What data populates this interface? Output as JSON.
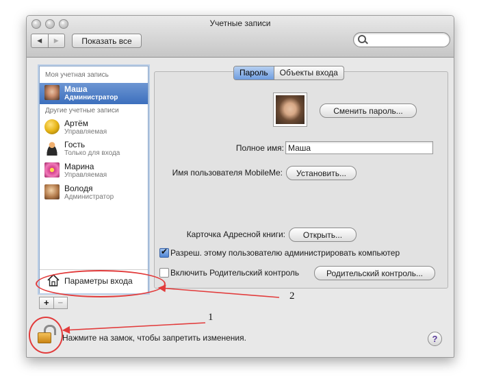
{
  "window": {
    "title": "Учетные записи"
  },
  "toolbar": {
    "back_label": "◀",
    "forward_label": "▶",
    "show_all_label": "Показать все",
    "search_placeholder": ""
  },
  "sidebar": {
    "my_account_header": "Моя учетная запись",
    "my_account": {
      "name": "Маша",
      "role": "Администратор",
      "avatar_color": "#c98b6a"
    },
    "other_accounts_header": "Другие учетные записи",
    "others": [
      {
        "name": "Артём",
        "role": "Управляемая",
        "avatar_color": "#e6b417"
      },
      {
        "name": "Гость",
        "role": "Только для входа",
        "avatar_color": "#b26a2c"
      },
      {
        "name": "Марина",
        "role": "Управляемая",
        "avatar_color": "#d43c8c"
      },
      {
        "name": "Володя",
        "role": "Администратор",
        "avatar_color": "#b27a4a"
      }
    ],
    "login_options_label": "Параметры входа",
    "add_label": "+",
    "remove_label": "−"
  },
  "tabs": [
    {
      "label": "Пароль",
      "active": true
    },
    {
      "label": "Объекты входа",
      "active": false
    }
  ],
  "password_panel": {
    "change_password_label": "Сменить пароль...",
    "full_name_label": "Полное имя:",
    "full_name_value": "Маша",
    "mobileme_label": "Имя пользователя MobileMe:",
    "mobileme_button": "Установить...",
    "address_card_label": "Карточка Адресной книги:",
    "address_card_button": "Открыть...",
    "allow_admin_label": "Разреш. этому пользователю администрировать компьютер",
    "allow_admin_checked": true,
    "parental_label": "Включить Родительский контроль",
    "parental_checked": false,
    "parental_button": "Родительский контроль..."
  },
  "footer": {
    "lock_text": "Нажмите на замок, чтобы запретить изменения.",
    "help_label": "?"
  },
  "annotations": {
    "marker_1": "1",
    "marker_2": "2",
    "color": "#e23b3b"
  }
}
